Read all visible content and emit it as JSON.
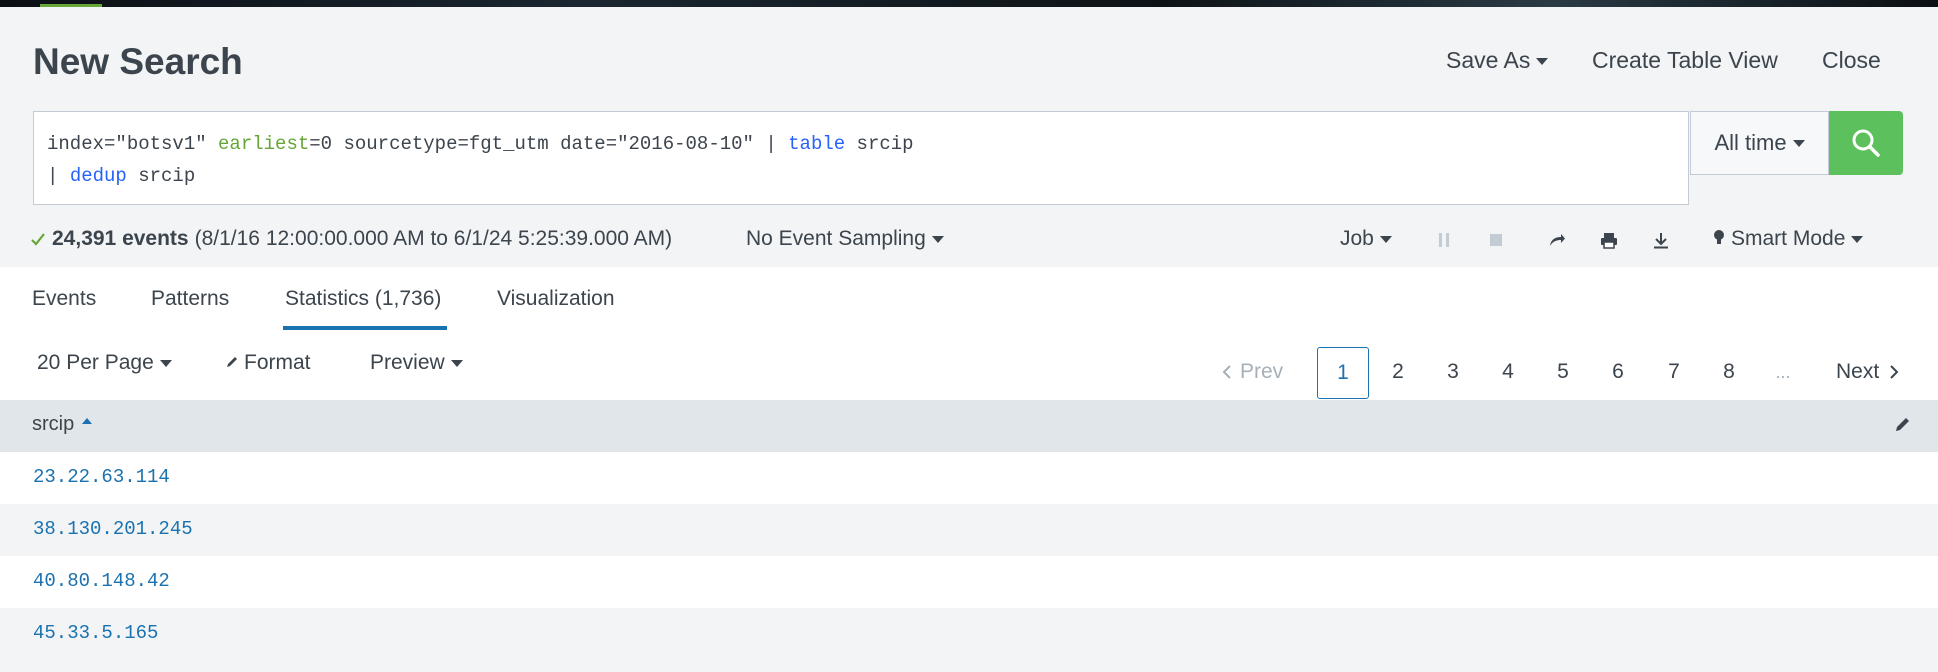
{
  "header": {
    "title": "New Search",
    "save_as": "Save As",
    "create_table_view": "Create Table View",
    "close": "Close"
  },
  "search": {
    "line1": {
      "p1": "index=\"botsv1\" ",
      "earliest": "earliest",
      "p2": "=0 sourcetype=fgt_utm date=\"2016-08-10\" | ",
      "table": "table",
      "p3": " srcip"
    },
    "line2": {
      "pipe": "| ",
      "dedup": "dedup",
      "p1": " srcip"
    },
    "time_range": "All time",
    "search_icon": "search-icon"
  },
  "status": {
    "check_icon": "check-icon",
    "events": "24,391 events",
    "range": "(8/1/16 12:00:00.000 AM to 6/1/24 5:25:39.000 AM)",
    "sampling": "No Event Sampling",
    "job": "Job",
    "mode": "Smart Mode"
  },
  "tabs": [
    {
      "label": "Events"
    },
    {
      "label": "Patterns"
    },
    {
      "label": "Statistics (1,736)"
    },
    {
      "label": "Visualization"
    }
  ],
  "toolbar": {
    "per_page": "20 Per Page",
    "format": "Format",
    "preview": "Preview"
  },
  "pagination": {
    "prev": "Prev",
    "pages": [
      "1",
      "2",
      "3",
      "4",
      "5",
      "6",
      "7",
      "8"
    ],
    "ellipsis": "...",
    "next": "Next",
    "current": "1"
  },
  "table": {
    "column": "srcip",
    "rows": [
      "23.22.63.114",
      "38.130.201.245",
      "40.80.148.42",
      "45.33.5.165"
    ]
  },
  "colors": {
    "accent_green": "#5cc05c",
    "link_blue": "#1a72b0",
    "keyword_blue": "#2662fc",
    "keyword_green": "#65a637"
  }
}
